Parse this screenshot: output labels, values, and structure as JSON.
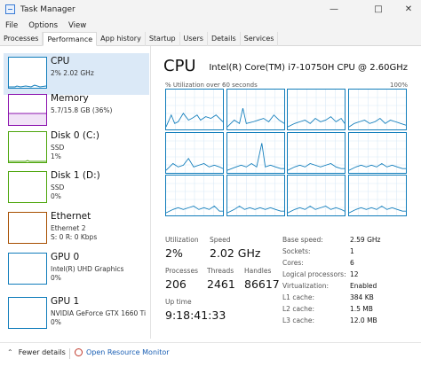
{
  "window": {
    "title": "Task Manager"
  },
  "menu": [
    "File",
    "Options",
    "View"
  ],
  "tabs": [
    "Processes",
    "Performance",
    "App history",
    "Startup",
    "Users",
    "Details",
    "Services"
  ],
  "active_tab": "Performance",
  "resources": [
    {
      "name": "CPU",
      "sub1": "2% 2.02 GHz",
      "sub2": "",
      "color": "#117dbb",
      "selected": true
    },
    {
      "name": "Memory",
      "sub1": "5.7/15.8 GB (36%)",
      "sub2": "",
      "color": "#8b12ae"
    },
    {
      "name": "Disk 0 (C:)",
      "sub1": "SSD",
      "sub2": "1%",
      "color": "#4da60c"
    },
    {
      "name": "Disk 1 (D:)",
      "sub1": "SSD",
      "sub2": "0%",
      "color": "#4da60c"
    },
    {
      "name": "Ethernet",
      "sub1": "Ethernet 2",
      "sub2": "S: 0 R: 0 Kbps",
      "color": "#a74f01"
    },
    {
      "name": "GPU 0",
      "sub1": "Intel(R) UHD Graphics",
      "sub2": "0%",
      "color": "#117dbb"
    },
    {
      "name": "GPU 1",
      "sub1": "NVIDIA GeForce GTX 1660 Ti",
      "sub2": "0%",
      "color": "#117dbb"
    }
  ],
  "cpu": {
    "title": "CPU",
    "model": "Intel(R) Core(TM) i7-10750H CPU @ 2.60GHz",
    "util_label": "% Utilization over 60 seconds",
    "util_max": "100%",
    "stats": {
      "utilization_label": "Utilization",
      "utilization": "2%",
      "speed_label": "Speed",
      "speed": "2.02 GHz",
      "processes_label": "Processes",
      "processes": "206",
      "threads_label": "Threads",
      "threads": "2461",
      "handles_label": "Handles",
      "handles": "86617",
      "uptime_label": "Up time",
      "uptime": "9:18:41:33"
    },
    "details": [
      {
        "key": "Base speed:",
        "value": "2.59 GHz"
      },
      {
        "key": "Sockets:",
        "value": "1"
      },
      {
        "key": "Cores:",
        "value": "6"
      },
      {
        "key": "Logical processors:",
        "value": "12"
      },
      {
        "key": "Virtualization:",
        "value": "Enabled"
      },
      {
        "key": "L1 cache:",
        "value": "384 KB"
      },
      {
        "key": "L2 cache:",
        "value": "1.5 MB"
      },
      {
        "key": "L3 cache:",
        "value": "12.0 MB"
      }
    ]
  },
  "footer": {
    "fewer_details": "Fewer details",
    "open_monitor": "Open Resource Monitor"
  },
  "colors": {
    "accent": "#117dbb",
    "selected_bg": "#dbe9f7",
    "link": "#1a5fb4"
  },
  "icons": [
    "task-manager-icon",
    "minimize-icon",
    "maximize-icon",
    "close-icon",
    "chevron-up-icon",
    "resource-monitor-icon"
  ]
}
